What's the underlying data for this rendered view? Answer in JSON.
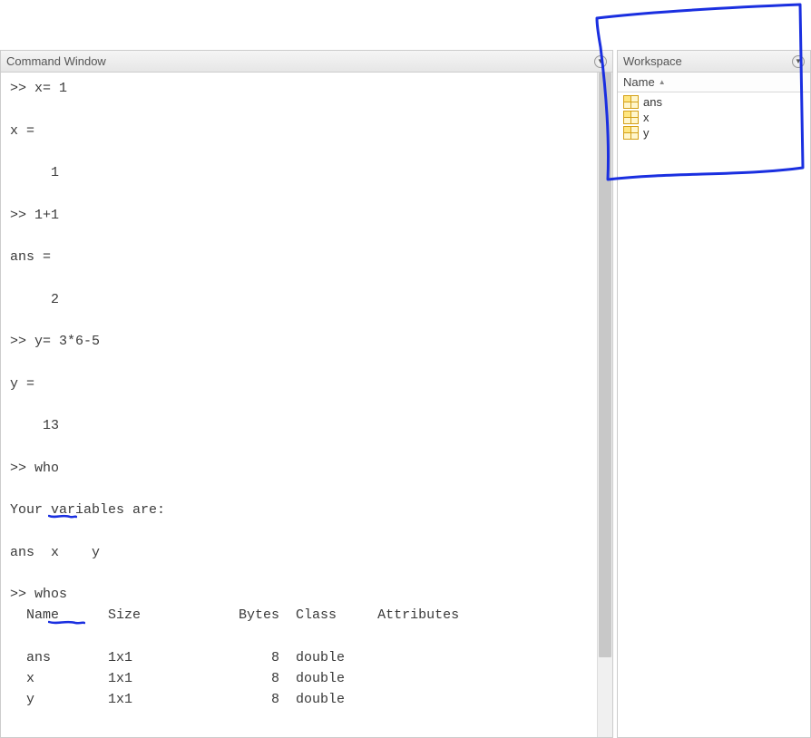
{
  "command_window": {
    "title": "Command Window",
    "lines": [
      ">> x= 1",
      "",
      "x =",
      "",
      "     1",
      "",
      ">> 1+1",
      "",
      "ans =",
      "",
      "     2",
      "",
      ">> y= 3*6-5",
      "",
      "y =",
      "",
      "    13",
      "",
      ">> who",
      "",
      "Your variables are:",
      "",
      "ans  x    y  ",
      "",
      ">> whos",
      "  Name      Size            Bytes  Class     Attributes",
      "",
      "  ans       1x1                 8  double              ",
      "  x         1x1                 8  double              ",
      "  y         1x1                 8  double              "
    ]
  },
  "workspace": {
    "title": "Workspace",
    "column_header": "Name",
    "variables": [
      {
        "name": "ans"
      },
      {
        "name": "x"
      },
      {
        "name": "y"
      }
    ]
  },
  "annotation": {
    "color": "#1a2fe0"
  }
}
